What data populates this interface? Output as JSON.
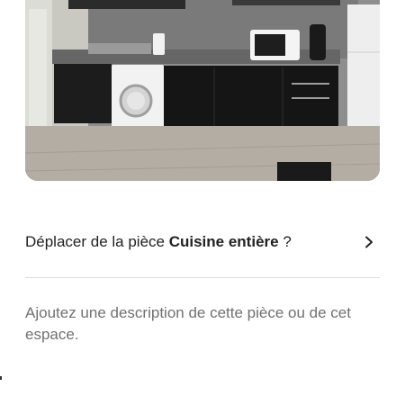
{
  "photo": {
    "subject": "kitchen-photo"
  },
  "room_move": {
    "prefix": "Déplacer de la pièce ",
    "room_name": "Cuisine entière",
    "suffix": " ?",
    "chevron_icon": "chevron-right-icon"
  },
  "description": {
    "placeholder": "Ajoutez une description de cette pièce ou de cet espace.",
    "value": ""
  },
  "colors": {
    "text": "#222222",
    "placeholder": "#717171",
    "divider": "#dddddd"
  }
}
